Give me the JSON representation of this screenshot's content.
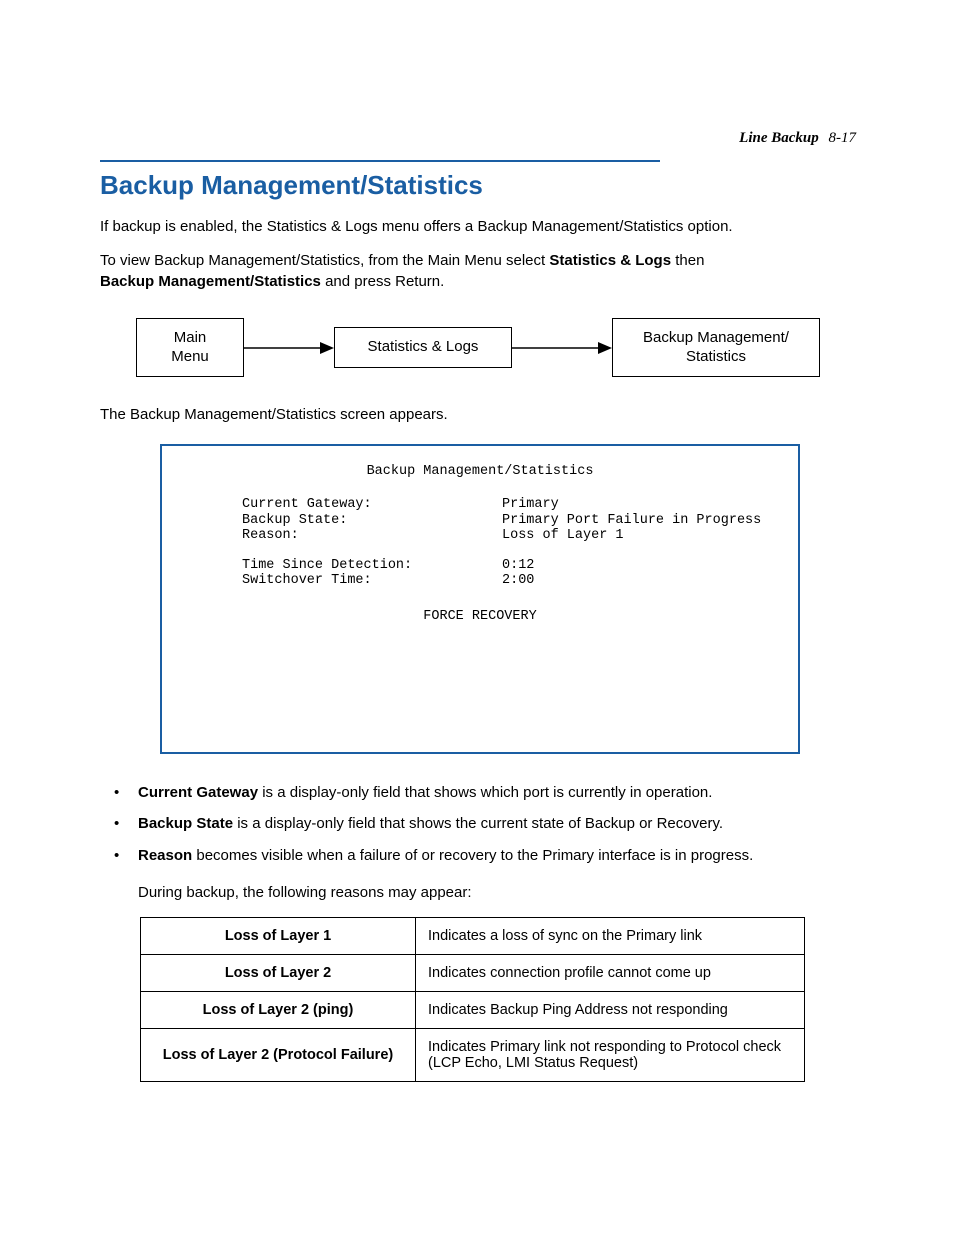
{
  "header": {
    "section": "Line Backup",
    "page": "8-17"
  },
  "title": "Backup Management/Statistics",
  "para1": "If backup is enabled, the Statistics & Logs menu offers a Backup Management/Statistics option.",
  "para2a": "To view Backup Management/Statistics, from the Main Menu select ",
  "para2b": "Statistics & Logs",
  "para2c": " then ",
  "para2d": "Backup Management/Statistics",
  "para2e": " and press Return.",
  "flow": {
    "box1a": "Main",
    "box1b": "Menu",
    "box2": "Statistics & Logs",
    "box3a": "Backup Management/",
    "box3b": "Statistics"
  },
  "para3": "The Backup Management/Statistics screen appears.",
  "screen": {
    "title": "Backup Management/Statistics",
    "rows": [
      {
        "label": "Current Gateway:",
        "value": "Primary"
      },
      {
        "label": "Backup State:",
        "value": "Primary Port Failure in Progress"
      },
      {
        "label": "Reason:",
        "value": "Loss of Layer 1"
      }
    ],
    "rows2": [
      {
        "label": "Time Since Detection:",
        "value": "0:12"
      },
      {
        "label": "Switchover Time:",
        "value": "2:00"
      }
    ],
    "action": "FORCE RECOVERY"
  },
  "bullets": [
    {
      "term": "Current Gateway",
      "rest": " is a display-only field that shows which port is currently in operation."
    },
    {
      "term": "Backup State",
      "rest": " is a display-only field that shows the current state of Backup or Recovery."
    },
    {
      "term": "Reason",
      "rest": " becomes visible when a failure of or recovery to the Primary interface is in progress."
    }
  ],
  "indent_after_bullets": "During backup, the following reasons may appear:",
  "table": [
    {
      "k": "Loss of Layer 1",
      "v": "Indicates a loss of sync on the Primary link"
    },
    {
      "k": "Loss of Layer 2",
      "v": "Indicates connection profile cannot come up"
    },
    {
      "k": "Loss of Layer 2 (ping)",
      "v": "Indicates Backup Ping Address not responding"
    },
    {
      "k": "Loss of Layer 2 (Protocol Failure)",
      "v": "Indicates Primary link not responding to Protocol check (LCP Echo, LMI Status Request)"
    }
  ]
}
